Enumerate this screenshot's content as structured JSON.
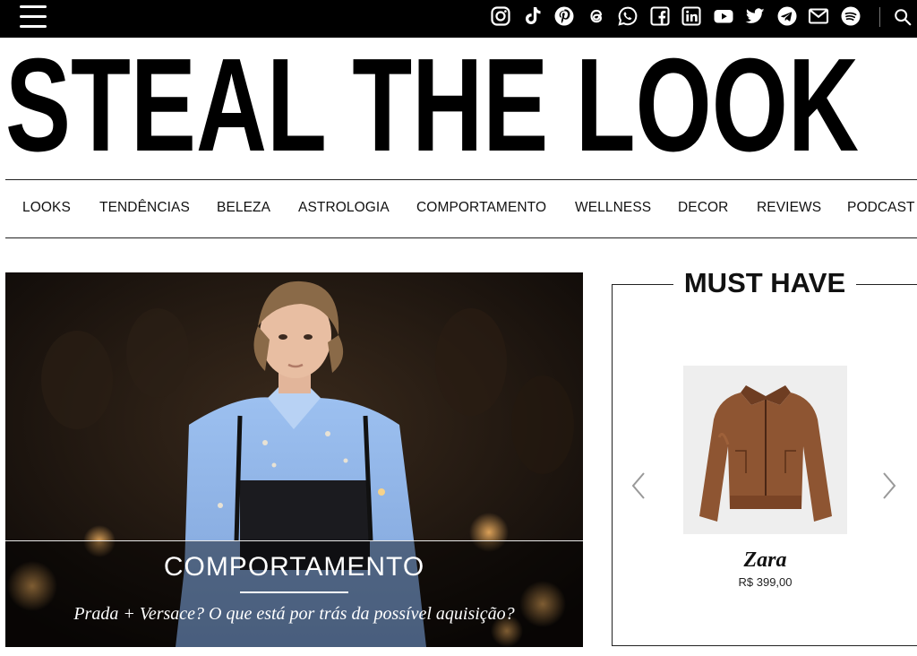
{
  "site": {
    "logo_text": "STEAL THE LOOK"
  },
  "topbar": {
    "social_icons": [
      "instagram-icon",
      "tiktok-icon",
      "pinterest-icon",
      "threads-icon",
      "whatsapp-icon",
      "facebook-icon",
      "linkedin-icon",
      "youtube-icon",
      "twitter-icon",
      "telegram-icon",
      "email-icon",
      "spotify-icon"
    ],
    "search_icon": "search-icon"
  },
  "nav": {
    "items": [
      {
        "label": "LOOKS"
      },
      {
        "label": "TENDÊNCIAS"
      },
      {
        "label": "BELEZA"
      },
      {
        "label": "ASTROLOGIA"
      },
      {
        "label": "COMPORTAMENTO"
      },
      {
        "label": "WELLNESS"
      },
      {
        "label": "DECOR"
      },
      {
        "label": "REVIEWS"
      },
      {
        "label": "PODCAST"
      }
    ]
  },
  "hero": {
    "category": "COMPORTAMENTO",
    "title": "Prada + Versace? O que está por trás da possível aquisição?"
  },
  "must_have": {
    "heading": "MUST HAVE",
    "product": {
      "brand": "Zara",
      "price": "R$ 399,00"
    }
  },
  "colors": {
    "topbar": "#000000",
    "accent": "#111111"
  }
}
